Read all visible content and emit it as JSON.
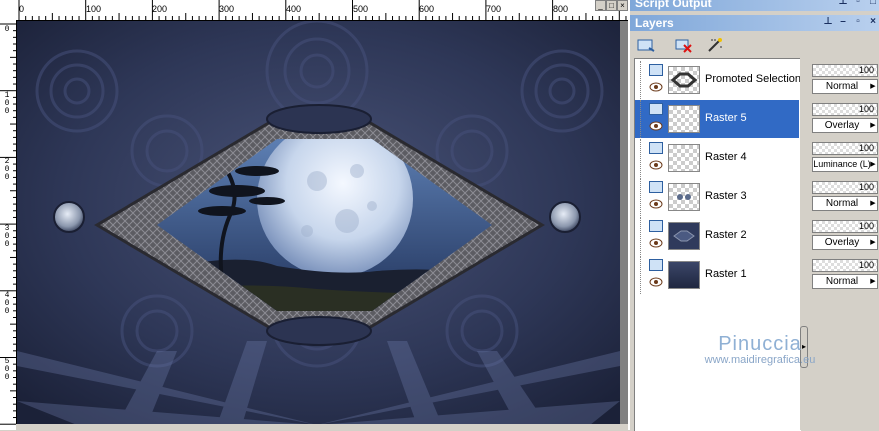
{
  "ruler": {
    "h_ticks": [
      "0",
      "100",
      "200",
      "300",
      "400",
      "500",
      "600",
      "700",
      "800"
    ],
    "v_ticks": [
      "0",
      "100",
      "200",
      "300",
      "400",
      "500"
    ]
  },
  "script_output": {
    "title": "Script Output"
  },
  "layers_palette": {
    "title": "Layers",
    "layers": [
      {
        "name": "Promoted Selection",
        "opacity": "100",
        "blend": "Normal",
        "selected": false
      },
      {
        "name": "Raster 5",
        "opacity": "100",
        "blend": "Overlay",
        "selected": true
      },
      {
        "name": "Raster 4",
        "opacity": "100",
        "blend": "Luminance (L)",
        "selected": false
      },
      {
        "name": "Raster 3",
        "opacity": "100",
        "blend": "Normal",
        "selected": false
      },
      {
        "name": "Raster 2",
        "opacity": "100",
        "blend": "Overlay",
        "selected": false
      },
      {
        "name": "Raster 1",
        "opacity": "100",
        "blend": "Normal",
        "selected": false
      }
    ]
  },
  "watermark": {
    "name": "Pinuccia",
    "url": "www.maidiregrafica.eu"
  },
  "colors": {
    "selection": "#316ac5",
    "titlebar": "#7fa7d9",
    "canvas_bg": "#2a3352"
  }
}
